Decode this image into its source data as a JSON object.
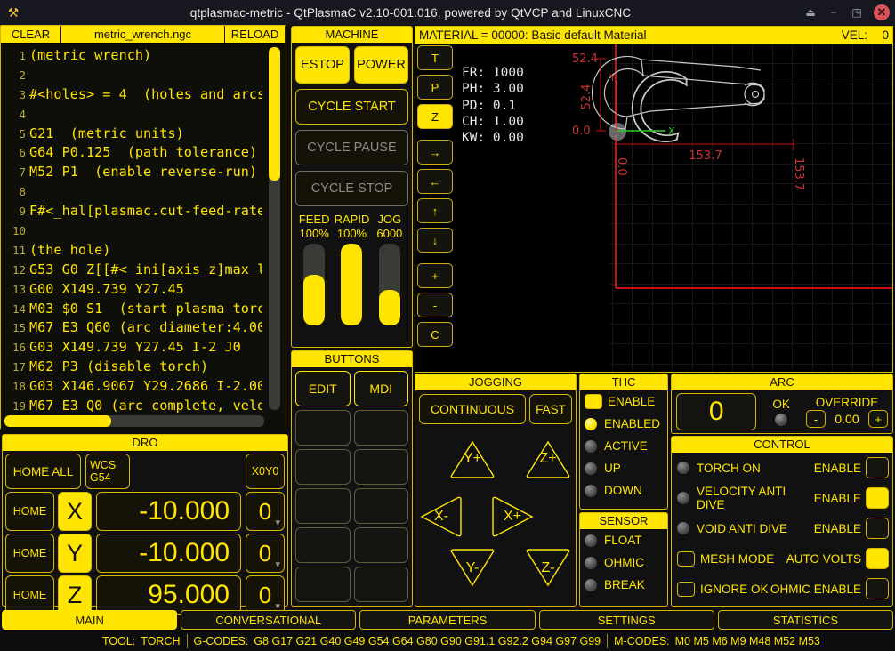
{
  "window": {
    "title": "qtplasmac-metric - QtPlasmaC v2.10-001.016, powered by QtVCP and LinuxCNC",
    "app_icon": "plasma-torch-icon",
    "buttons": {
      "shade": "⏏",
      "minimize": "−",
      "maximize": "◳",
      "close": "✕"
    }
  },
  "editor": {
    "clear_label": "CLEAR",
    "file_name": "metric_wrench.ngc",
    "reload_label": "RELOAD",
    "lines": [
      {
        "n": "1",
        "code": "(metric wrench)"
      },
      {
        "n": "2",
        "code": ""
      },
      {
        "n": "3",
        "code": "#<holes> = 4  (holes and arcs"
      },
      {
        "n": "4",
        "code": ""
      },
      {
        "n": "5",
        "code": "G21  (metric units)"
      },
      {
        "n": "6",
        "code": "G64 P0.125  (path tolerance)"
      },
      {
        "n": "7",
        "code": "M52 P1  (enable reverse-run)"
      },
      {
        "n": "8",
        "code": ""
      },
      {
        "n": "9",
        "code": "F#<_hal[plasmac.cut-feed-rate"
      },
      {
        "n": "10",
        "code": ""
      },
      {
        "n": "11",
        "code": "(the hole)"
      },
      {
        "n": "12",
        "code": "G53 G0 Z[[#<_ini[axis_z]max_l"
      },
      {
        "n": "13",
        "code": "G00 X149.739 Y27.45"
      },
      {
        "n": "14",
        "code": "M03 $0 S1  (start plasma torc"
      },
      {
        "n": "15",
        "code": "M67 E3 Q60 (arc diameter:4.00"
      },
      {
        "n": "16",
        "code": "G03 X149.739 Y27.45 I-2 J0"
      },
      {
        "n": "17",
        "code": "M62 P3 (disable torch)"
      },
      {
        "n": "18",
        "code": "G03 X146.9067 Y29.2686 I-2.00"
      },
      {
        "n": "19",
        "code": "M67 E3 Q0 (arc complete, velo"
      }
    ]
  },
  "dro": {
    "title": "DRO",
    "home_all_label": "HOME ALL",
    "wcs_line1": "WCS",
    "wcs_line2": "G54",
    "x0y0_label": "X0Y0",
    "axes": [
      {
        "home_label": "HOME",
        "axis": "X",
        "value": "-10.000",
        "selector": "0"
      },
      {
        "home_label": "HOME",
        "axis": "Y",
        "value": "-10.000",
        "selector": "0"
      },
      {
        "home_label": "HOME",
        "axis": "Z",
        "value": "95.000",
        "selector": "0"
      }
    ]
  },
  "machine": {
    "title": "MACHINE",
    "estop_label": "ESTOP",
    "power_label": "POWER",
    "cycle_start_label": "CYCLE START",
    "cycle_pause_label": "CYCLE PAUSE",
    "cycle_stop_label": "CYCLE STOP",
    "sliders": [
      {
        "name": "FEED",
        "value": "100%",
        "percent": 62
      },
      {
        "name": "RAPID",
        "value": "100%",
        "percent": 100
      },
      {
        "name": "JOG",
        "value": "6000",
        "percent": 43
      }
    ]
  },
  "buttons_panel": {
    "title": "BUTTONS",
    "items": [
      "EDIT",
      "MDI",
      "",
      "",
      "",
      "",
      "",
      "",
      "",
      "",
      "",
      ""
    ]
  },
  "preview": {
    "material_label": "MATERIAL =  00000: Basic default Material",
    "vel_label": "VEL:",
    "vel_value": "0",
    "view_buttons": [
      {
        "name": "view-t-button",
        "label": "T",
        "active": false
      },
      {
        "name": "view-p-button",
        "label": "P",
        "active": false
      },
      {
        "name": "view-z-button",
        "label": "Z",
        "active": true
      },
      {
        "name": "pan-right-button",
        "label": "→",
        "active": false
      },
      {
        "name": "pan-left-button",
        "label": "←",
        "active": false
      },
      {
        "name": "pan-up-button",
        "label": "↑",
        "active": false
      },
      {
        "name": "pan-down-button",
        "label": "↓",
        "active": false
      },
      {
        "name": "zoom-in-button",
        "label": "+",
        "active": false
      },
      {
        "name": "zoom-out-button",
        "label": "-",
        "active": false
      },
      {
        "name": "clear-view-button",
        "label": "C",
        "active": false
      }
    ],
    "info": "FR: 1000\nPH: 3.00\nPD: 0.1\nCH: 1.00\nKW: 0.00",
    "dimensions": {
      "y_top": "52.4",
      "y_side": "52.4",
      "y_bottom": "0.0",
      "x_left": "0.0",
      "x_span": "153.7",
      "x_right": "153.7",
      "x_axis_label": "X",
      "y_axis_label": "Y"
    }
  },
  "jogging": {
    "title": "JOGGING",
    "mode_label": "CONTINUOUS",
    "speed_label": "FAST",
    "pad": [
      {
        "name": "jog-y-plus-button",
        "label": "Y+"
      },
      {
        "name": "jog-z-plus-button",
        "label": "Z+"
      },
      {
        "name": "jog-x-minus-button",
        "label": "X-"
      },
      {
        "name": "jog-x-plus-button",
        "label": "X+"
      },
      {
        "name": "jog-y-minus-button",
        "label": "Y-"
      },
      {
        "name": "jog-z-minus-button",
        "label": "Z-"
      }
    ]
  },
  "thc": {
    "title": "THC",
    "enable_label": "ENABLE",
    "enable_checked": true,
    "leds": [
      {
        "label": "ENABLED",
        "on": true
      },
      {
        "label": "ACTIVE",
        "on": false
      },
      {
        "label": "UP",
        "on": false
      },
      {
        "label": "DOWN",
        "on": false
      }
    ]
  },
  "sensor": {
    "title": "SENSOR",
    "leds": [
      {
        "label": "FLOAT",
        "on": false
      },
      {
        "label": "OHMIC",
        "on": false
      },
      {
        "label": "BREAK",
        "on": false
      }
    ]
  },
  "arc": {
    "title": "ARC",
    "voltage": "0",
    "ok_label": "OK",
    "ok_on": false,
    "override_label": "OVERRIDE",
    "override_minus": "-",
    "override_value": "0.00",
    "override_plus": "+"
  },
  "control": {
    "title": "CONTROL",
    "rows": [
      {
        "type": "led",
        "led_on": false,
        "label": "TORCH ON",
        "action": "ENABLE",
        "box_on": false
      },
      {
        "type": "led",
        "led_on": false,
        "label": "VELOCITY ANTI DIVE",
        "action": "ENABLE",
        "box_on": true
      },
      {
        "type": "led",
        "led_on": false,
        "label": "VOID ANTI DIVE",
        "action": "ENABLE",
        "box_on": false
      },
      {
        "type": "chk",
        "chk_on": false,
        "label": "MESH MODE",
        "action": "AUTO VOLTS",
        "box_on": true
      },
      {
        "type": "chk",
        "chk_on": false,
        "label": "IGNORE OK",
        "action": "OHMIC ENABLE",
        "box_on": false
      }
    ]
  },
  "tabs": [
    {
      "label": "MAIN",
      "active": true
    },
    {
      "label": "CONVERSATIONAL",
      "active": false
    },
    {
      "label": "PARAMETERS",
      "active": false
    },
    {
      "label": "SETTINGS",
      "active": false
    },
    {
      "label": "STATISTICS",
      "active": false
    }
  ],
  "statusbar": {
    "tool_label": "TOOL:",
    "tool_value": "TORCH",
    "gcodes_label": "G-CODES:",
    "gcodes_value": "G8 G17 G21 G40 G49 G54 G64 G80 G90 G91.1 G92.2 G94 G97 G99",
    "mcodes_label": "M-CODES:",
    "mcodes_value": "M0 M5 M6 M9 M48 M52 M53"
  },
  "colors": {
    "accent": "#ffe500",
    "border": "#d7b800",
    "background": "#0d0d0d",
    "panel_bg": "#111111",
    "titlebar": "#17171f",
    "plot_path": "#c8c8c8",
    "plot_axis_red": "#cc1111",
    "close_red": "#d9545a"
  }
}
